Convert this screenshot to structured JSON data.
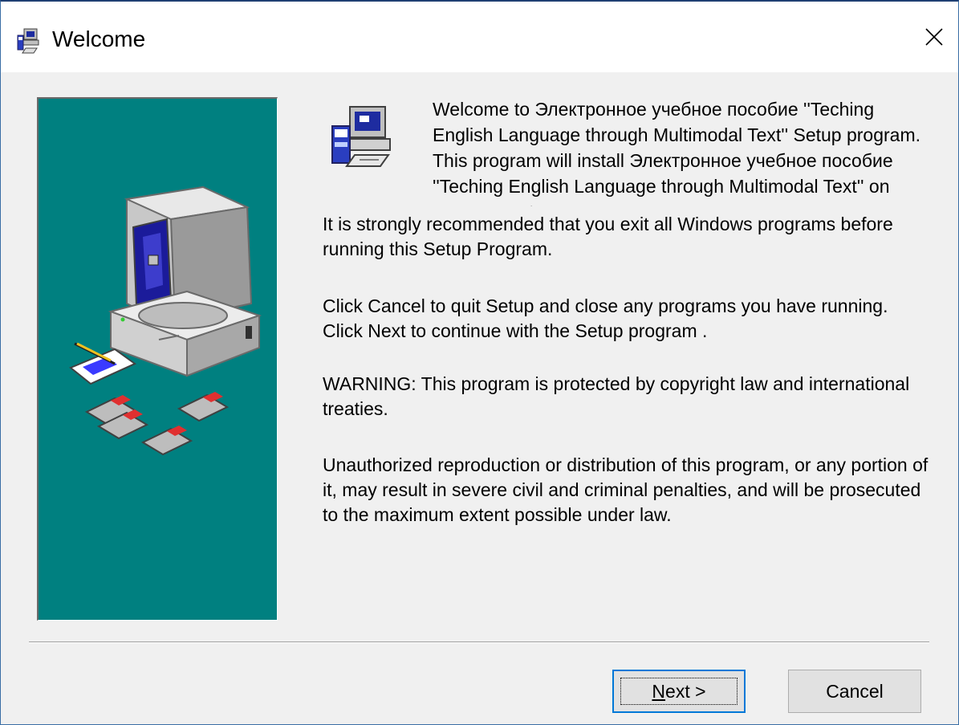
{
  "window": {
    "title": "Welcome",
    "title_icon": "setup-app-icon",
    "close_icon": "close-icon"
  },
  "side_panel": {
    "background_color": "#008080",
    "illustration": "computer-with-floppy-disks-illustration"
  },
  "content": {
    "icon": "setup-computer-icon",
    "welcome_text": "Welcome to Электронное учебное пособие ''Teching English Language through Multimodal Text'' Setup program. This program will install Электронное учебное пособие ''Teching English Language through Multimodal Text'' on your computer.",
    "paragraphs": [
      "It is strongly recommended that you exit all Windows programs before running this Setup Program.",
      "Click Cancel to quit Setup and close any programs you have running.  Click Next to continue with the Setup program .",
      "WARNING: This program is protected by copyright law and international treaties.",
      "Unauthorized reproduction or distribution of this program, or any portion of it, may result in severe civil and criminal penalties, and will be prosecuted to the maximum extent possible under law."
    ]
  },
  "buttons": {
    "next_mnemonic": "N",
    "next_rest": "ext >",
    "cancel_label": "Cancel"
  },
  "colors": {
    "panel_teal": "#008080",
    "focus_blue": "#0078d7",
    "dialog_bg": "#f0f0f0"
  }
}
